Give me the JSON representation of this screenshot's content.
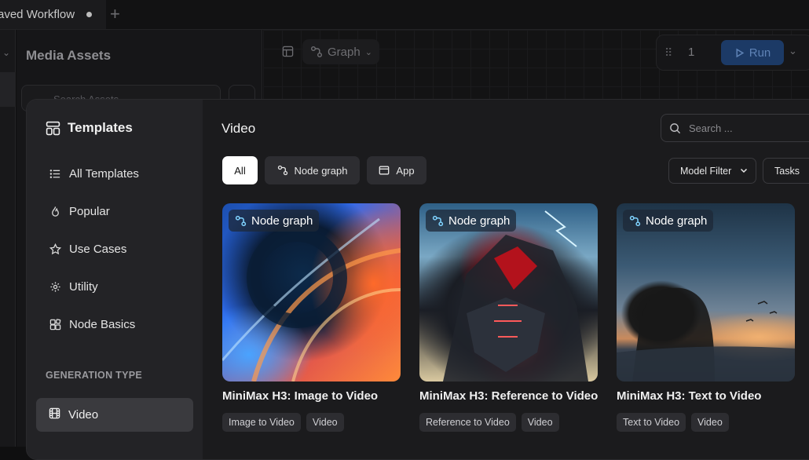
{
  "topbar": {
    "tab_title": "aved Workflow",
    "add_label": "+"
  },
  "media_panel": {
    "title": "Media Assets",
    "search_placeholder": "Search Assets"
  },
  "canvas": {
    "graph_label": "Graph",
    "run_count": "1",
    "run_label": "Run"
  },
  "modal": {
    "sidebar": {
      "title": "Templates",
      "items": [
        {
          "label": "All Templates",
          "icon": "list-icon"
        },
        {
          "label": "Popular",
          "icon": "flame-icon"
        },
        {
          "label": "Use Cases",
          "icon": "star-icon"
        },
        {
          "label": "Utility",
          "icon": "gear-icon"
        },
        {
          "label": "Node Basics",
          "icon": "blocks-icon"
        }
      ],
      "section_label": "GENERATION TYPE",
      "active_item": {
        "label": "Video",
        "icon": "film-icon"
      }
    },
    "main": {
      "title": "Video",
      "search_placeholder": "Search ...",
      "filters": {
        "all": "All",
        "node_graph": "Node graph",
        "app": "App"
      },
      "model_filter": "Model Filter",
      "tasks": "Tasks",
      "cards": [
        {
          "badge": "Node graph",
          "title": "MiniMax H3: Image to Video",
          "tags": [
            "Image to Video",
            "Video"
          ]
        },
        {
          "badge": "Node graph",
          "title": "MiniMax H3: Reference to Video",
          "tags": [
            "Reference to Video",
            "Video"
          ]
        },
        {
          "badge": "Node graph",
          "title": "MiniMax H3: Text to Video",
          "tags": [
            "Text to Video",
            "Video"
          ]
        }
      ]
    }
  },
  "colors": {
    "accent_run": "#1c3a66",
    "active_sidebar": "#3a3a3e",
    "chip_selected": "#ffffff",
    "badge_icon": "#7fd3ff"
  }
}
